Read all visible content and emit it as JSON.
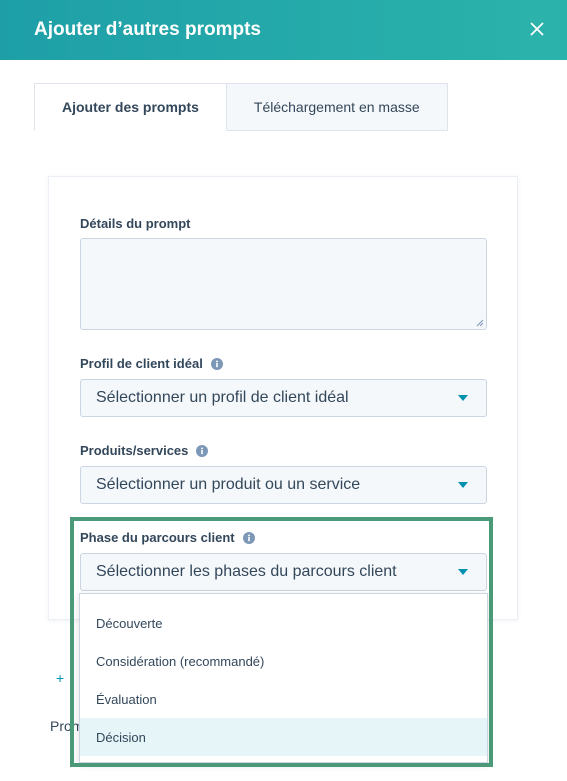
{
  "header": {
    "title": "Ajouter d’autres prompts"
  },
  "tabs": [
    {
      "label": "Ajouter des prompts",
      "active": true
    },
    {
      "label": "Téléchargement en masse",
      "active": false
    }
  ],
  "form": {
    "prompt_details": {
      "label": "Détails du prompt",
      "value": ""
    },
    "icp": {
      "label": "Profil de client idéal",
      "selected": "Sélectionner un profil de client idéal"
    },
    "products": {
      "label": "Produits/services",
      "selected": "Sélectionner un produit ou un service"
    },
    "journey_phase": {
      "label": "Phase du parcours client",
      "selected": "Sélectionner les phases du parcours client",
      "options": [
        "Découverte",
        "Considération (recommandé)",
        "Évaluation",
        "Décision"
      ],
      "hovered_option": "Décision"
    }
  },
  "background_fragments": {
    "add_symbol": "+",
    "partial_text": "Prom"
  },
  "colors": {
    "header_start": "#1e9fa8",
    "header_end": "#2bb3ab",
    "accent": "#0091ae",
    "highlight_border": "#4a9a7a",
    "hover_bg": "#e5f5f8"
  },
  "icons": [
    "close-icon",
    "info-icon",
    "chevron-down-icon",
    "resize-handle-icon"
  ]
}
